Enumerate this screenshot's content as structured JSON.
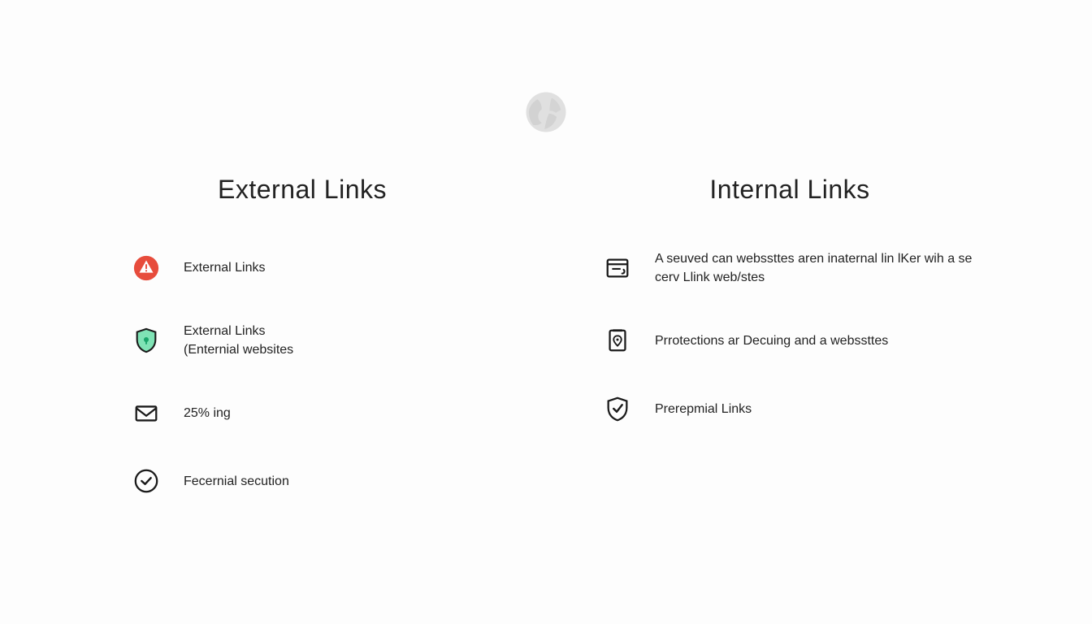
{
  "left": {
    "title": "External Links",
    "items": [
      {
        "label": "External Links"
      },
      {
        "label": "External Links",
        "sub": "(Enternial websites"
      },
      {
        "label": "25% ing"
      },
      {
        "label": "Fecernial secution"
      }
    ]
  },
  "right": {
    "title": "Internal Links",
    "items": [
      {
        "label": "A seuved can webssttes aren inaternal lin lKer wih a se cerv Llink web/stes"
      },
      {
        "label": "Prrotections ar Decuing and a webssttes"
      },
      {
        "label": "Prerepmial Links"
      }
    ]
  }
}
